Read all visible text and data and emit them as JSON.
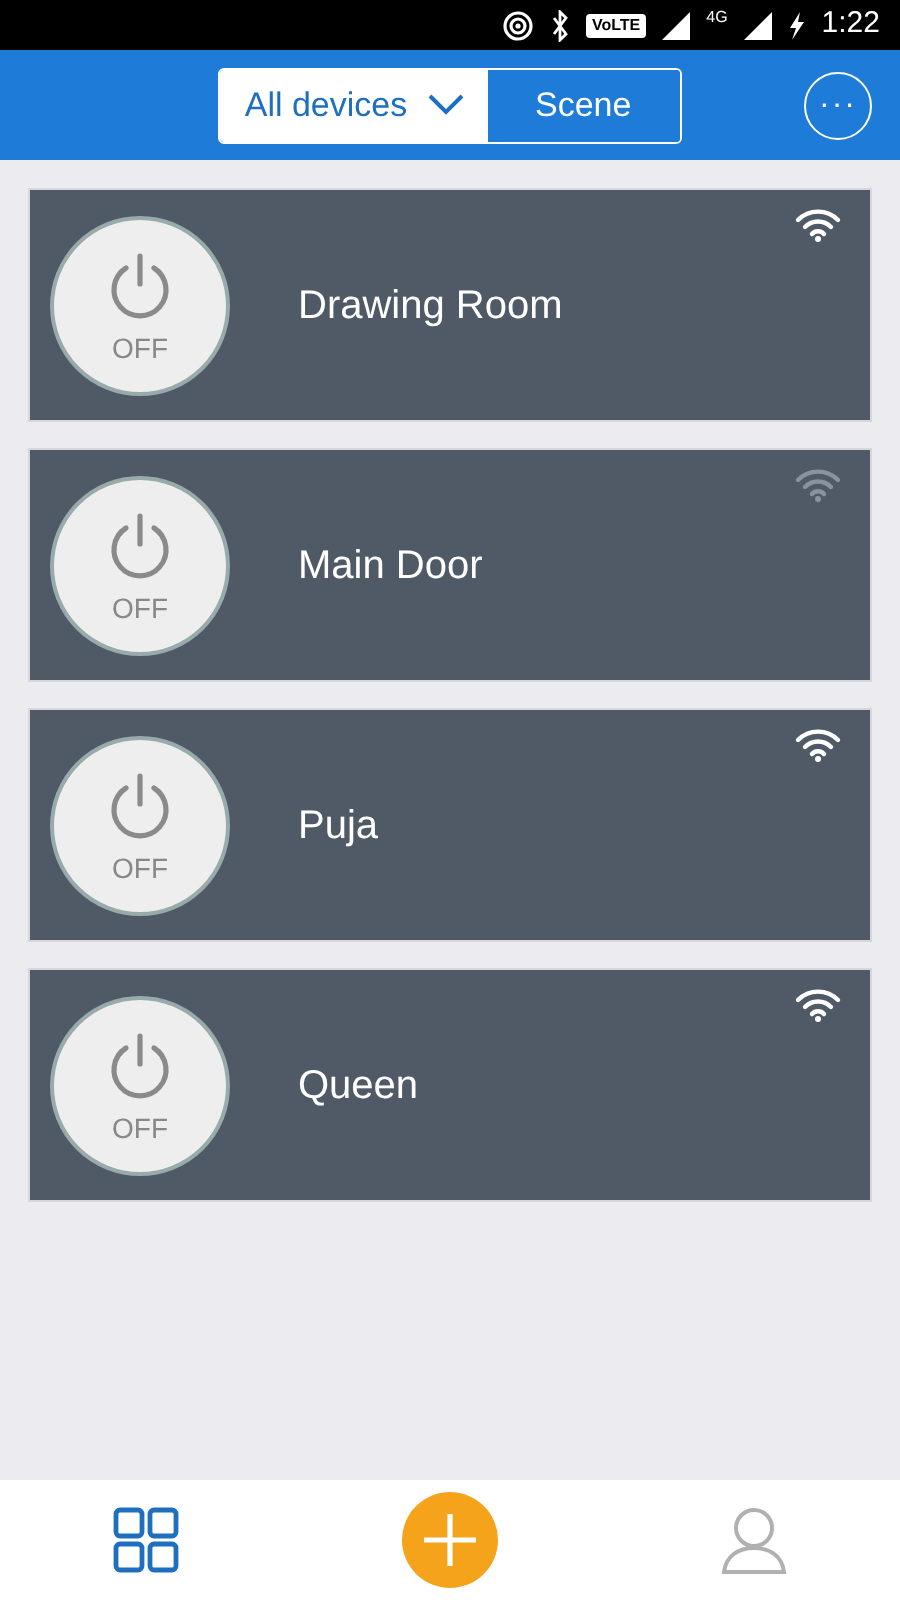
{
  "status_bar": {
    "volte": "VoLTE",
    "network": "4G",
    "time": "1:22"
  },
  "header": {
    "tabs": [
      {
        "label": "All devices",
        "selected": true,
        "dropdown": true
      },
      {
        "label": "Scene",
        "selected": false,
        "dropdown": false
      }
    ],
    "more_button": "···"
  },
  "devices": [
    {
      "name": "Drawing Room",
      "state": "OFF",
      "on": false,
      "online": true
    },
    {
      "name": "Main Door",
      "state": "OFF",
      "on": false,
      "online": false
    },
    {
      "name": "Puja",
      "state": "OFF",
      "on": false,
      "online": true
    },
    {
      "name": "Queen",
      "state": "OFF",
      "on": false,
      "online": true
    }
  ],
  "bottom_nav": [
    {
      "kind": "devices",
      "selected": true
    },
    {
      "kind": "add",
      "selected": false
    },
    {
      "kind": "profile",
      "selected": false
    }
  ]
}
